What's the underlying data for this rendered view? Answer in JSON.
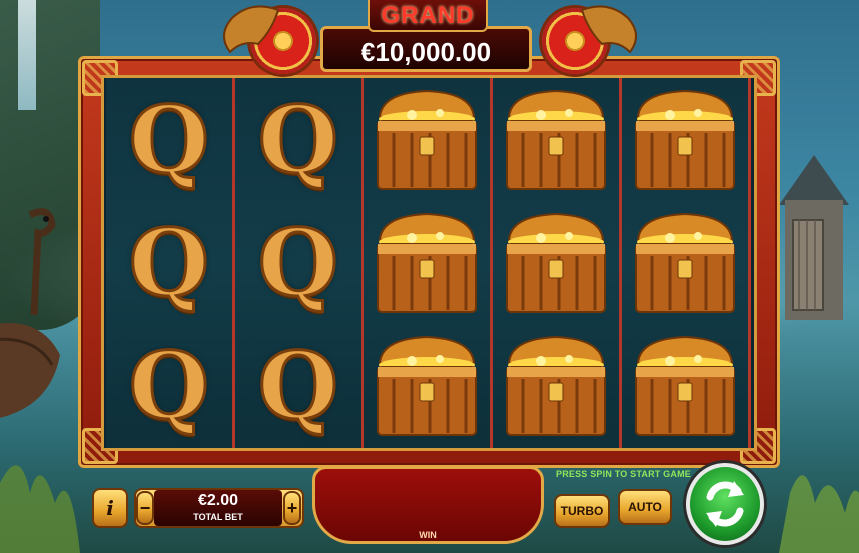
{
  "jackpot": {
    "label": "GRAND",
    "value": "€10,000.00"
  },
  "reels": [
    {
      "symbols": [
        "q-symbol",
        "q-symbol",
        "q-symbol"
      ]
    },
    {
      "symbols": [
        "q-symbol",
        "q-symbol",
        "q-symbol"
      ]
    },
    {
      "symbols": [
        "treasure-chest",
        "treasure-chest",
        "treasure-chest"
      ]
    },
    {
      "symbols": [
        "treasure-chest",
        "treasure-chest",
        "treasure-chest"
      ]
    },
    {
      "symbols": [
        "treasure-chest",
        "treasure-chest",
        "treasure-chest"
      ]
    }
  ],
  "q_glyph": "Q",
  "controls": {
    "info_label": "i",
    "minus_label": "−",
    "plus_label": "+",
    "bet_value": "€2.00",
    "bet_label": "TOTAL BET",
    "win_label": "WIN",
    "message": "PRESS SPIN TO START GAME",
    "turbo_label": "TURBO",
    "auto_label": "AUTO"
  },
  "icons": {
    "spin": "refresh-arrows-icon",
    "info": "info-icon"
  },
  "colors": {
    "frame": "#a92814",
    "gold": "#e3a947",
    "reel_bg": "#0f3440",
    "spin_green": "#1d9a2b",
    "message_green": "#8fe65a"
  }
}
